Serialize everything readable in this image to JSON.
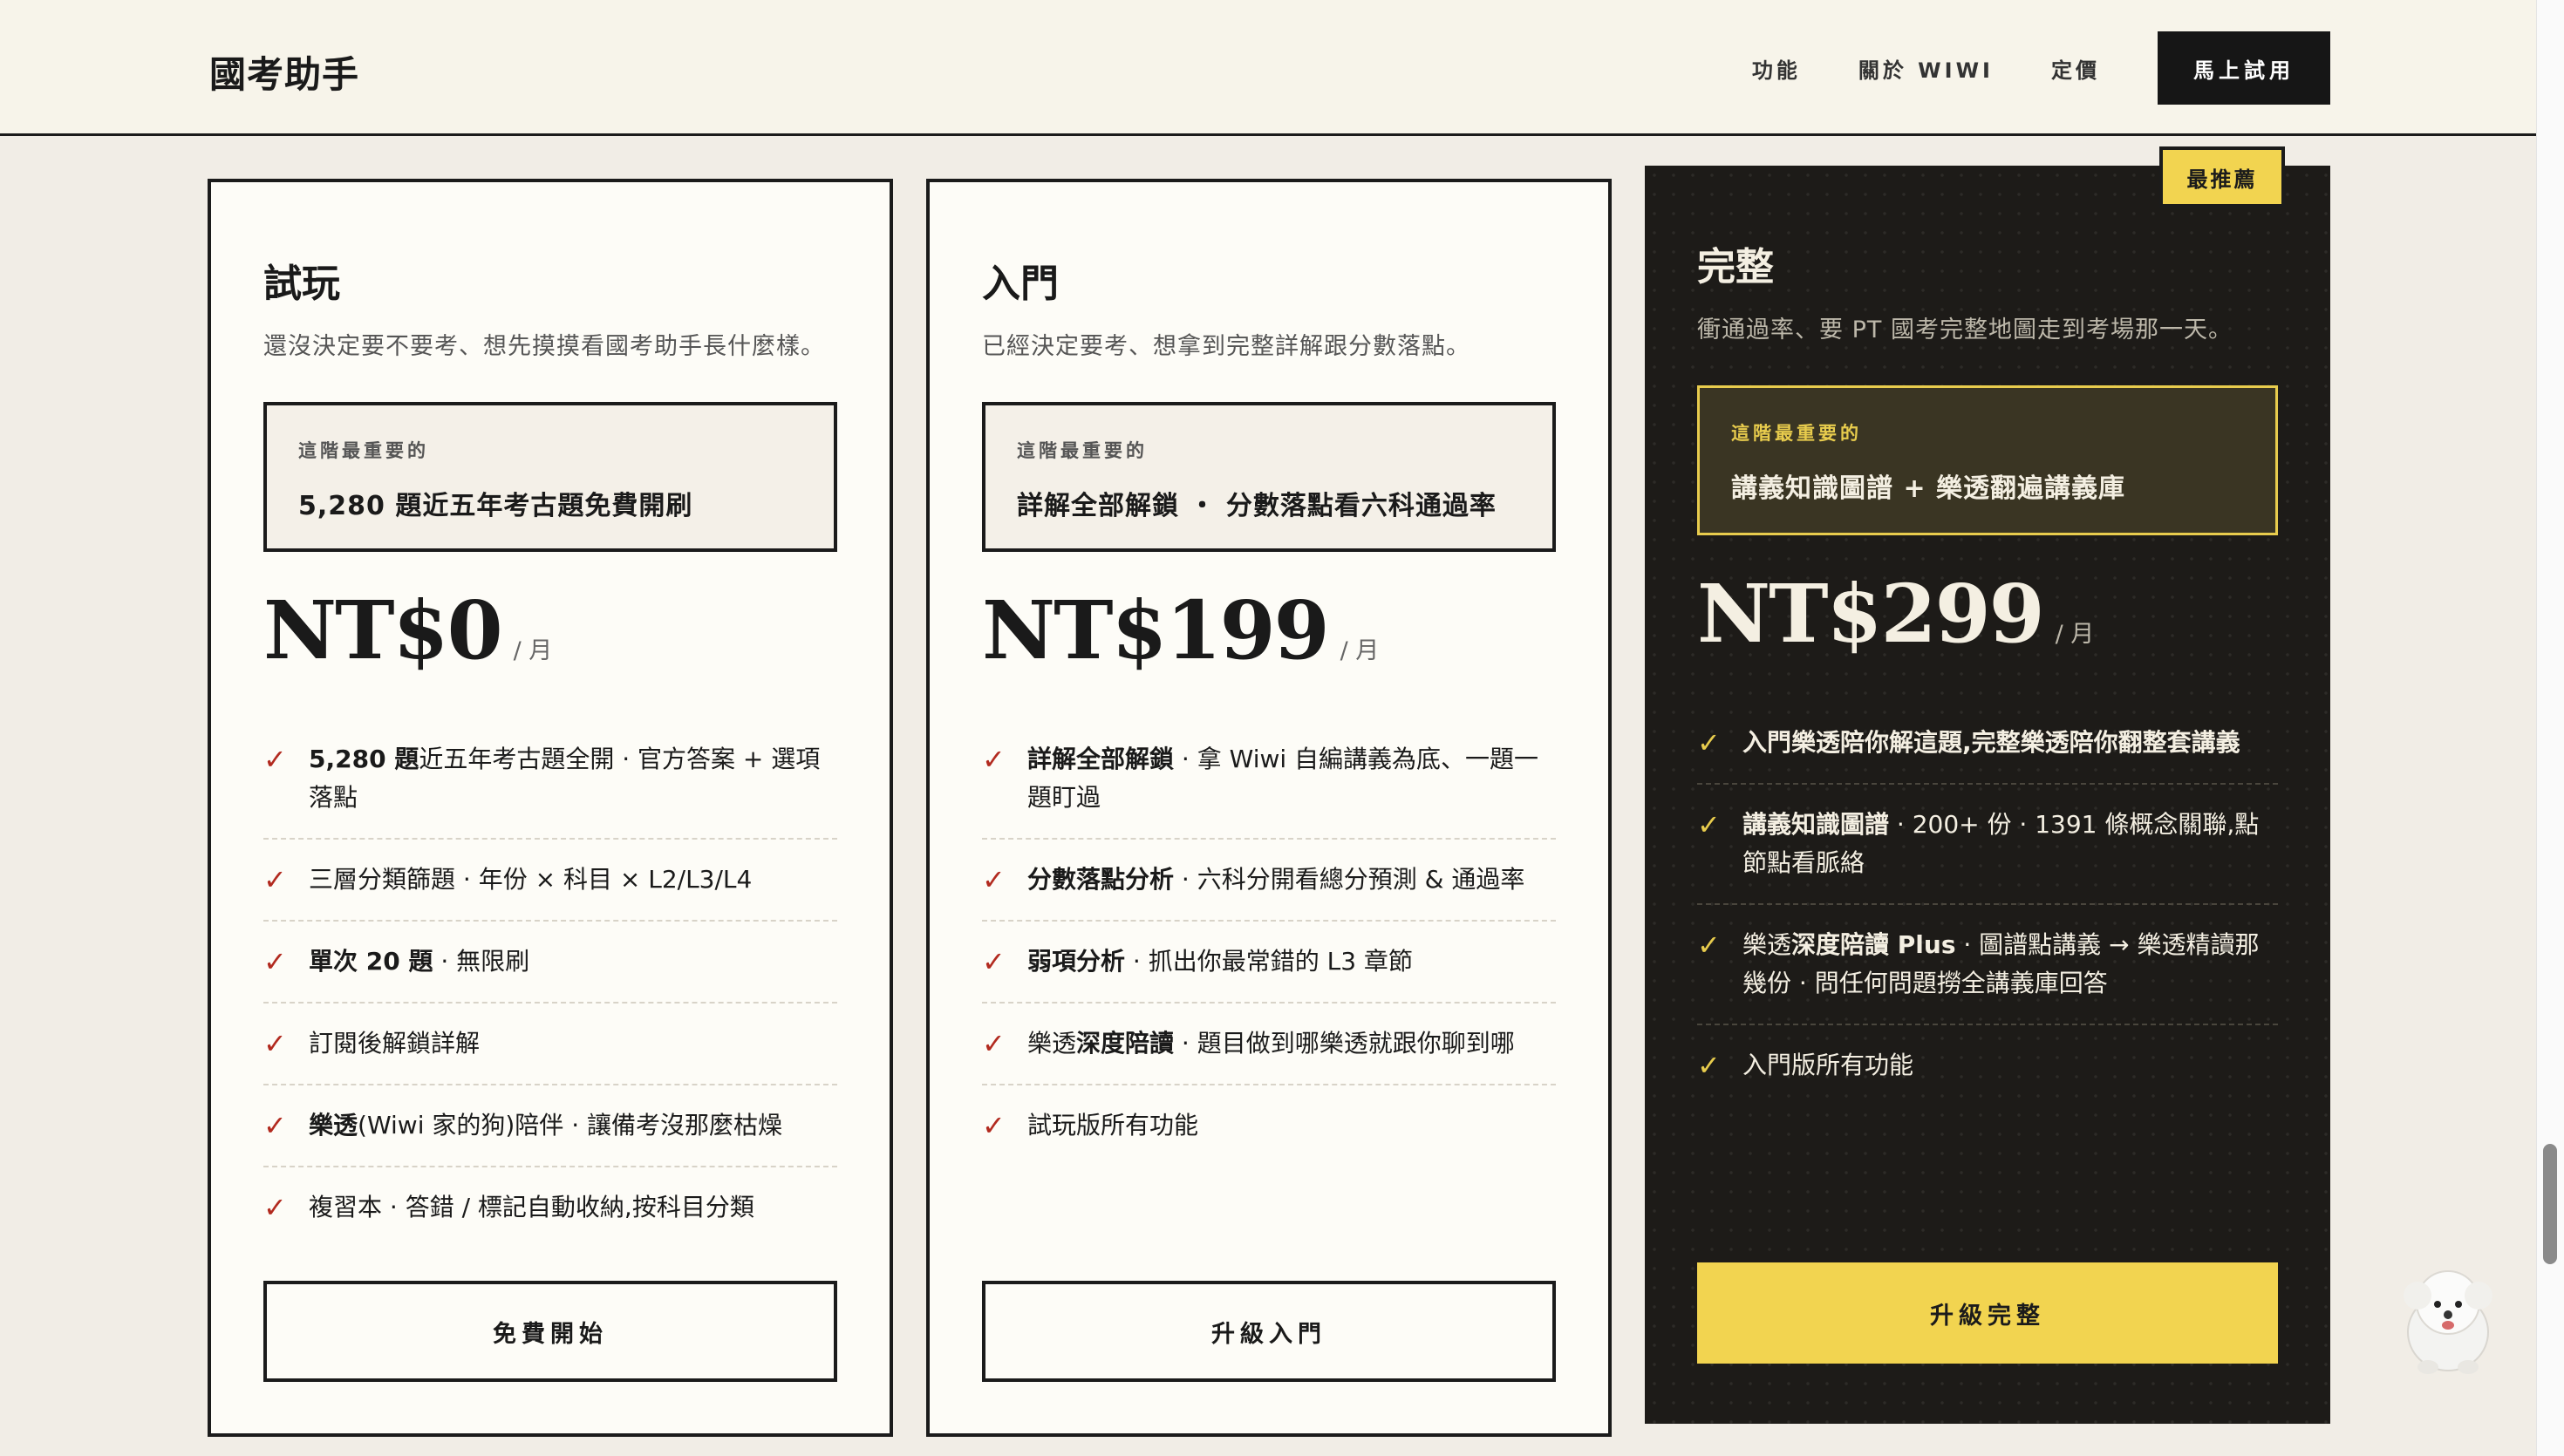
{
  "header": {
    "brand": "國考助手",
    "nav": [
      "功能",
      "關於 WIWI",
      "定價"
    ],
    "cta": "馬上試用"
  },
  "plans": [
    {
      "name": "試玩",
      "desc": "還沒決定要不要考、想先摸摸看國考助手長什麼樣。",
      "highlight_label": "這階最重要的",
      "highlight_text": "5,280 題近五年考古題免費開刷",
      "price": "NT$0",
      "per": "/ 月",
      "features": [
        {
          "bold": "5,280 題",
          "text": "近五年考古題全開 · 官方答案 + 選項落點"
        },
        {
          "bold": "",
          "text": "三層分類篩題 · 年份 × 科目 × L2/L3/L4"
        },
        {
          "bold": "單次 20 題",
          "text": " · 無限刷"
        },
        {
          "bold": "",
          "text": "訂閱後解鎖詳解"
        },
        {
          "bold": "樂透",
          "text": "(Wiwi 家的狗)陪伴 · 讓備考沒那麼枯燥"
        },
        {
          "bold": "",
          "text": "複習本 · 答錯 / 標記自動收納,按科目分類"
        }
      ],
      "cta": "免費開始"
    },
    {
      "name": "入門",
      "desc": "已經決定要考、想拿到完整詳解跟分數落點。",
      "highlight_label": "這階最重要的",
      "highlight_text": "詳解全部解鎖 ・ 分數落點看六科通過率",
      "price": "NT$199",
      "per": "/ 月",
      "features": [
        {
          "bold": "詳解全部解鎖",
          "text": " · 拿 Wiwi 自編講義為底、一題一題盯過"
        },
        {
          "bold": "分數落點分析",
          "text": " · 六科分開看總分預測 & 通過率"
        },
        {
          "bold": "弱項分析",
          "text": " · 抓出你最常錯的 L3 章節"
        },
        {
          "pre": "樂透",
          "bold": "深度陪讀",
          "text": " · 題目做到哪樂透就跟你聊到哪"
        },
        {
          "bold": "",
          "text": "試玩版所有功能"
        }
      ],
      "cta": "升級入門"
    },
    {
      "name": "完整",
      "desc": "衝通過率、要 PT 國考完整地圖走到考場那一天。",
      "badge": "最推薦",
      "highlight_label": "這階最重要的",
      "highlight_text": "講義知識圖譜 + 樂透翻遍講義庫",
      "price": "NT$299",
      "per": "/ 月",
      "features": [
        {
          "bold": "入門樂透陪你解這題,完整樂透陪你翻整套講義",
          "text": ""
        },
        {
          "bold": "講義知識圖譜",
          "text": " · 200+ 份 · 1391 條概念關聯,點節點看脈絡"
        },
        {
          "pre": "樂透",
          "bold": "深度陪讀 Plus",
          "text": " · 圖譜點講義 → 樂透精讀那幾份 · 問任何問題撈全講義庫回答"
        },
        {
          "bold": "",
          "text": "入門版所有功能"
        }
      ],
      "cta": "升級完整"
    }
  ],
  "icons": {
    "check": "✓",
    "mascot": "dog-mascot-icon"
  },
  "colors": {
    "accent_yellow": "#f2d450",
    "check_red": "#b22a1f",
    "dark_card": "#1d1b18"
  }
}
